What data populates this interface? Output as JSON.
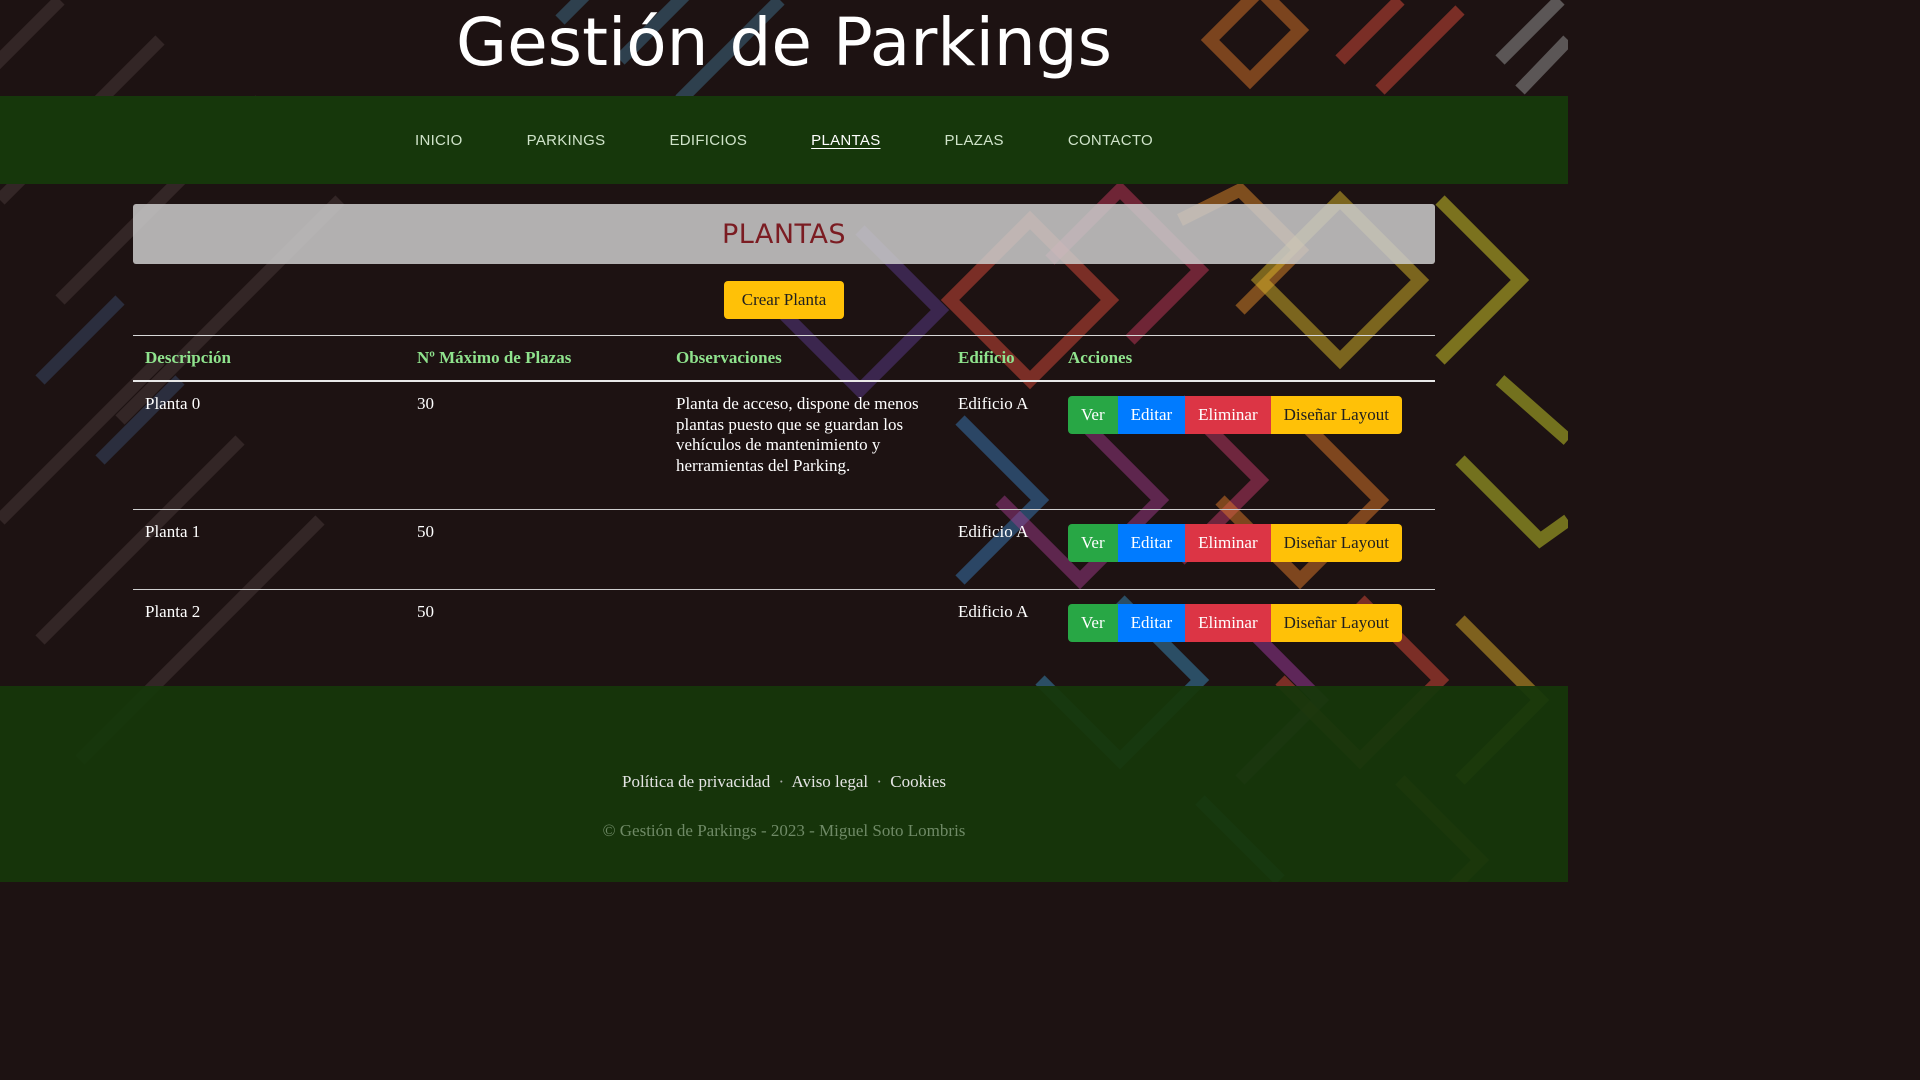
{
  "header": {
    "title": "Gestión de Parkings"
  },
  "nav": {
    "items": [
      {
        "label": "INICIO",
        "active": false
      },
      {
        "label": "PARKINGS",
        "active": false
      },
      {
        "label": "EDIFICIOS",
        "active": false
      },
      {
        "label": "PLANTAS",
        "active": true
      },
      {
        "label": "PLAZAS",
        "active": false
      },
      {
        "label": "CONTACTO",
        "active": false
      }
    ]
  },
  "main": {
    "heading": "PLANTAS",
    "create_button": "Crear Planta",
    "table": {
      "headers": [
        "Descripción",
        "Nº Máximo de Plazas",
        "Observaciones",
        "Edificio",
        "Acciones"
      ],
      "rows": [
        {
          "descripcion": "Planta 0",
          "max_plazas": "30",
          "observaciones": "Planta de acceso, dispone de menos plantas puesto que se guardan los vehículos de mantenimiento y herramientas del Parking.",
          "edificio": "Edificio A"
        },
        {
          "descripcion": "Planta 1",
          "max_plazas": "50",
          "observaciones": "",
          "edificio": "Edificio A"
        },
        {
          "descripcion": "Planta 2",
          "max_plazas": "50",
          "observaciones": "",
          "edificio": "Edificio A"
        }
      ],
      "actions": {
        "ver": "Ver",
        "editar": "Editar",
        "eliminar": "Eliminar",
        "layout": "Diseñar Layout"
      }
    }
  },
  "footer": {
    "links": [
      "Política de privacidad",
      "Aviso legal",
      "Cookies"
    ],
    "separator": "·",
    "copyright": "© Gestión de Parkings - 2023 - Miguel Soto Lombris"
  },
  "colors": {
    "navbar": "#16370b",
    "header_text": "#8fe38d",
    "heading": "#7b1c22",
    "btn_ver": "#28a745",
    "btn_editar": "#007bff",
    "btn_eliminar": "#dc3545",
    "btn_layout": "#ffc107"
  }
}
